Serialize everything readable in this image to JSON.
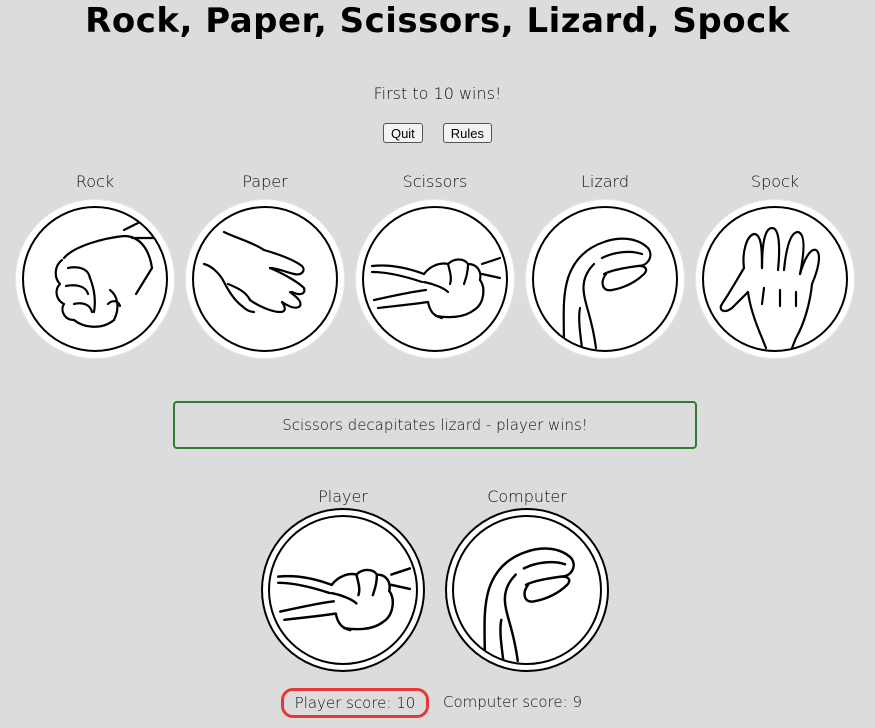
{
  "header": {
    "title": "Rock, Paper, Scissors, Lizard, Spock",
    "subtitle": "First to 10 wins!"
  },
  "controls": {
    "quit_label": "Quit",
    "rules_label": "Rules"
  },
  "choices": [
    {
      "label": "Rock",
      "icon": "rock-hand-icon"
    },
    {
      "label": "Paper",
      "icon": "paper-hand-icon"
    },
    {
      "label": "Scissors",
      "icon": "scissors-hand-icon"
    },
    {
      "label": "Lizard",
      "icon": "lizard-hand-icon"
    },
    {
      "label": "Spock",
      "icon": "spock-hand-icon"
    }
  ],
  "result": {
    "message": "Scissors decapitates lizard - player wins!",
    "border_color": "#2e7d32"
  },
  "round": {
    "player_label": "Player",
    "player_choice_icon": "scissors-hand-icon",
    "computer_label": "Computer",
    "computer_choice_icon": "lizard-hand-icon"
  },
  "scores": {
    "player": "Player score: 10",
    "computer": "Computer score: 9",
    "highlight_color": "#e53935"
  }
}
